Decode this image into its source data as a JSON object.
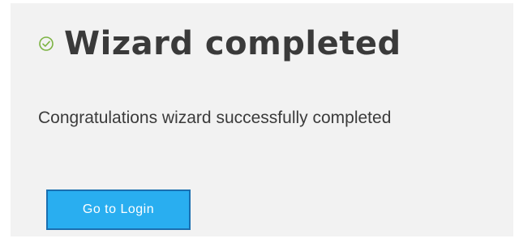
{
  "header": {
    "icon": "check-circle-icon",
    "icon_color": "#7cb342",
    "title": "Wizard completed"
  },
  "message": {
    "text": "Congratulations wizard successfully completed"
  },
  "actions": {
    "login_label": "Go to Login",
    "login_color": "#29aef0"
  }
}
